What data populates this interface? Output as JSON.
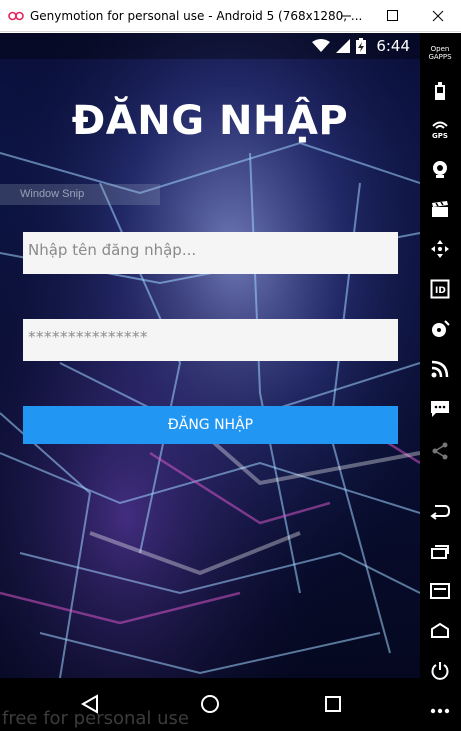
{
  "window": {
    "title": "Genymotion for personal use - Android 5 (768x1280, ...",
    "minimize_icon": "minimize-icon",
    "maximize_icon": "maximize-icon",
    "close_icon": "close-icon"
  },
  "statusbar": {
    "time": "6:44",
    "icons": [
      "wifi-icon",
      "signal-icon",
      "battery-charging-icon"
    ]
  },
  "login": {
    "title": "ĐĂNG NHẬP",
    "username_placeholder": "Nhập tên đăng nhập...",
    "username_value": "",
    "password_value": "***************",
    "button_label": "ĐĂNG NHẬP"
  },
  "overlay": {
    "window_snip": "Window Snip"
  },
  "android_nav": [
    "back-icon",
    "home-icon",
    "recents-icon"
  ],
  "watermark": "free for personal use",
  "sidebar": {
    "opengapps_label": "Open\nGAPPS",
    "gps_label": "GPS",
    "items": [
      "opengapps-icon",
      "battery-icon",
      "gps-icon",
      "camera-icon",
      "video-capture-icon",
      "dpad-icon",
      "device-id-icon",
      "disk-io-icon",
      "network-icon",
      "sms-icon",
      "share-icon",
      "back-icon",
      "recents-icon",
      "menu-icon",
      "home-icon",
      "power-icon",
      "more-icon"
    ]
  },
  "colors": {
    "accent": "#2196f3",
    "field_bg": "#f5f5f5",
    "screen_bg": "#060a2a"
  }
}
